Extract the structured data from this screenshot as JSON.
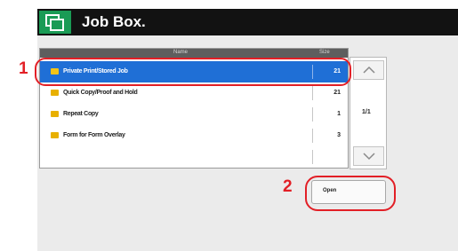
{
  "title": "Job Box.",
  "table": {
    "header_name": "Name",
    "header_size": "Size",
    "rows": [
      {
        "name": "Private Print/Stored Job",
        "count": "21",
        "selected": true
      },
      {
        "name": "Quick Copy/Proof and Hold",
        "count": "21",
        "selected": false
      },
      {
        "name": "Repeat Copy",
        "count": "1",
        "selected": false
      },
      {
        "name": "Form for Form Overlay",
        "count": "3",
        "selected": false
      },
      {
        "name": "",
        "count": "",
        "selected": false
      }
    ]
  },
  "page_indicator": "1/1",
  "open_button": "Open",
  "callouts": [
    "1",
    "2"
  ],
  "colors": {
    "accent_green": "#1a9b55",
    "selected_blue": "#1f6fd6",
    "callout_red": "#e21f26"
  },
  "icons": [
    "job-box-icon",
    "folder-icon",
    "chevron-up-icon",
    "chevron-down-icon"
  ]
}
